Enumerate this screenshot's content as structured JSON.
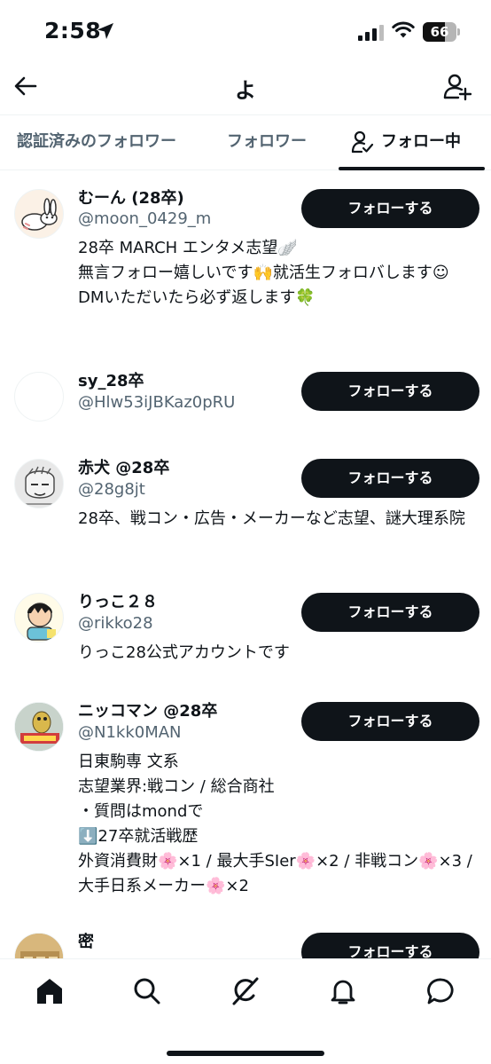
{
  "status_bar": {
    "time": "2:58",
    "battery": "66",
    "battery_level": 0.66
  },
  "header": {
    "title": "よ"
  },
  "tabs": [
    {
      "label": "認証済みのフォロワー"
    },
    {
      "label": "フォロワー"
    },
    {
      "label": "フォロー中"
    }
  ],
  "users": [
    {
      "name": "むーん (28卒)",
      "handle": "@moon_0429_m",
      "bio": "28卒 MARCH エンタメ志望🪽\n無言フォロー嬉しいです🙌就活生フォロバします☺︎\nDMいただいたら必ず返します🍀",
      "follow_label": "フォローする"
    },
    {
      "name": "sy_28卒",
      "handle": "@Hlw53iJBKaz0pRU",
      "bio": "",
      "follow_label": "フォローする"
    },
    {
      "name": "赤犬 @28卒",
      "handle": "@28g8jt",
      "bio": "28卒、戦コン・広告・メーカーなど志望、謎大理系院",
      "follow_label": "フォローする"
    },
    {
      "name": "りっこ２８",
      "handle": "@rikko28",
      "bio": "りっこ28公式アカウントです",
      "follow_label": "フォローする"
    },
    {
      "name": "ニッコマン @28卒",
      "handle": "@N1kk0MAN",
      "bio": "日東駒専 文系\n志望業界:戦コン / 総合商社\n・質問はmondで\n⬇️27卒就活戦歴\n外資消費財🌸×1 / 最大手SIer🌸×2 / 非戦コン🌸×3 / 大手日系メーカー🌸×2",
      "follow_label": "フォローする"
    },
    {
      "name": "密",
      "handle": "",
      "bio": "",
      "follow_label": "フォローする"
    }
  ],
  "icons": {
    "back": "arrow-left-icon",
    "add_user": "add-user-icon",
    "following_tab": "person-check-icon",
    "nav": [
      "home-icon",
      "search-icon",
      "grok-icon",
      "bell-icon",
      "message-icon"
    ]
  },
  "colors": {
    "text": "#0f1419",
    "secondary": "#536471",
    "button": "#0f1419",
    "divider": "#eff3f4"
  }
}
